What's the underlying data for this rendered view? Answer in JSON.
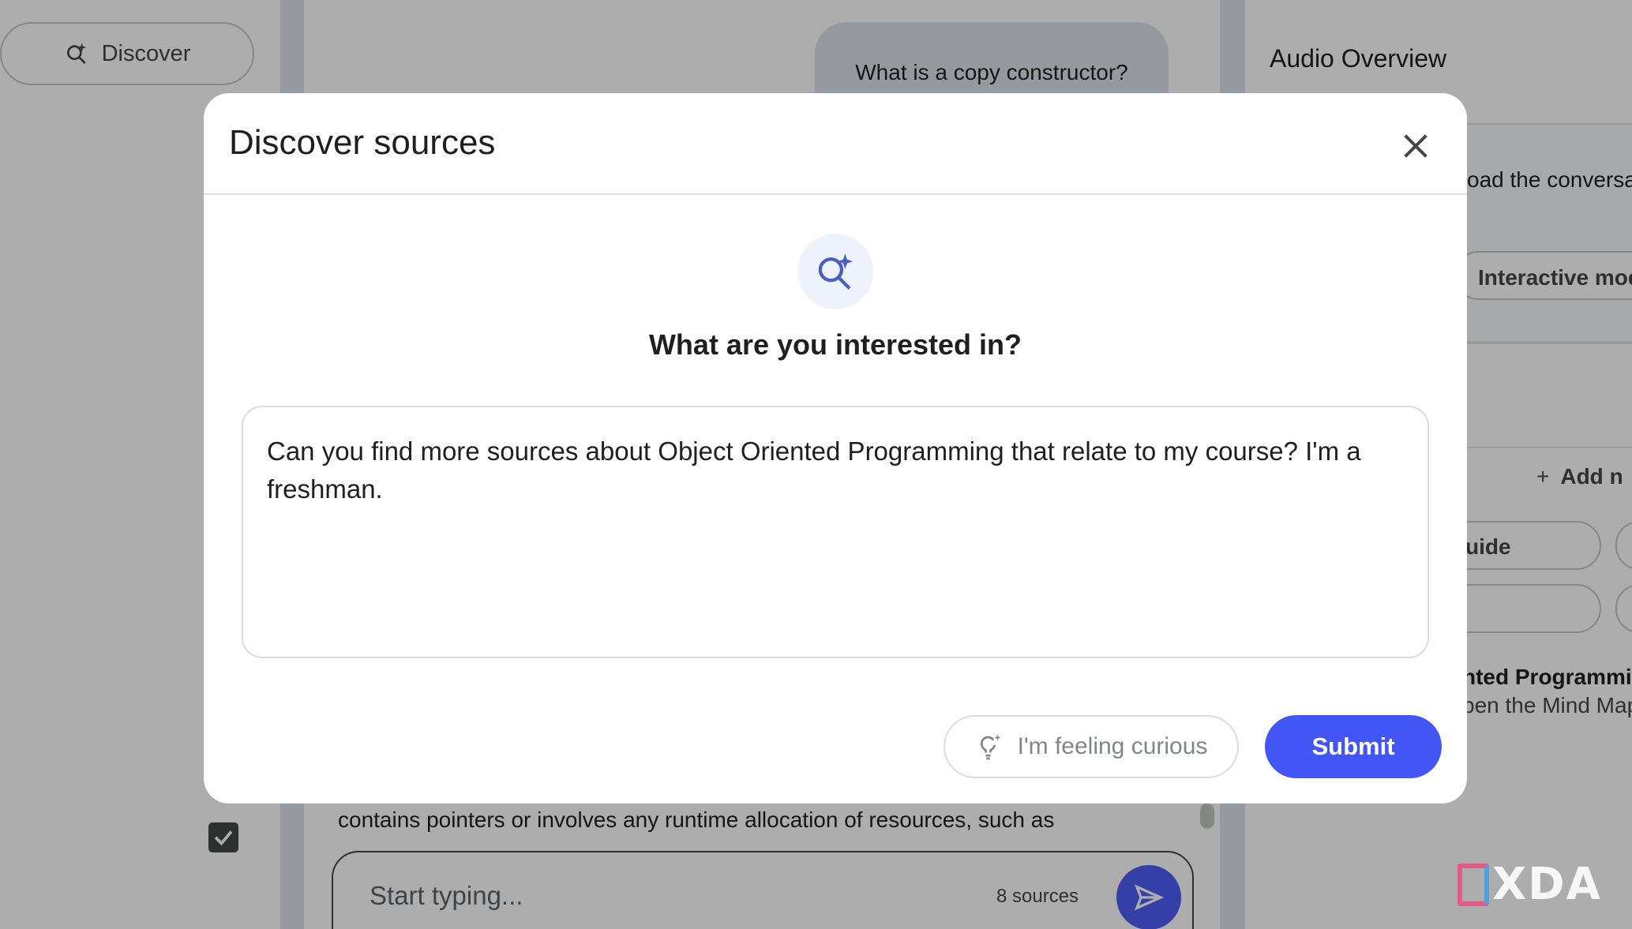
{
  "left_panel": {
    "discover_label": "Discover"
  },
  "chat": {
    "user_message": "What is a copy constructor?",
    "visible_text": "contains pointers or involves any runtime allocation of resources, such as",
    "input_placeholder": "Start typing...",
    "source_count": "8 sources"
  },
  "studio": {
    "title": "Audio Overview",
    "snippet_1": "oad the conversa",
    "interactive_label": "Interactive mod",
    "add_note_label": "Add n",
    "guide_label": "uide",
    "note_title": "nted Programmin",
    "note_subtitle": "pen the Mind Map"
  },
  "modal": {
    "title": "Discover sources",
    "prompt": "What are you interested in?",
    "query_value": "Can you find more sources about Object Oriented Programming that relate to my course? I'm a freshman.",
    "curious_label": "I'm feeling curious",
    "submit_label": "Submit"
  },
  "watermark": {
    "text": "XDA"
  },
  "colors": {
    "accent": "#4255f5",
    "scrim": "rgba(0,0,0,0.32)",
    "icon_tint": "#4a5fc1"
  }
}
